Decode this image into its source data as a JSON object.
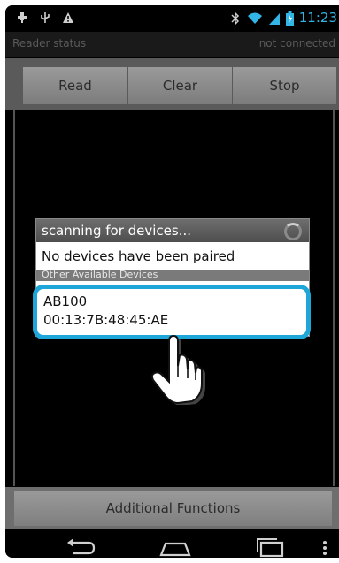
{
  "status_bar": {
    "time": "11:23",
    "left_icons": [
      "usb-icon",
      "usb-debug-icon",
      "warning-icon"
    ],
    "right_icons": [
      "bluetooth-icon",
      "wifi-icon",
      "signal-icon",
      "battery-icon"
    ]
  },
  "reader": {
    "label": "Reader status",
    "value": "not connected"
  },
  "toolbar": {
    "read_label": "Read",
    "clear_label": "Clear",
    "stop_label": "Stop"
  },
  "dialog": {
    "title": "scanning for devices...",
    "no_paired_text": "No devices have been paired",
    "section_header": "Other Available Devices",
    "devices": [
      {
        "name": "AB100",
        "address": "00:13:7B:48:45:AE"
      }
    ]
  },
  "bottom": {
    "additional_label": "Additional Functions"
  },
  "navigation": {
    "icons": [
      "back-icon",
      "home-icon",
      "recent-apps-icon",
      "menu-icon"
    ]
  },
  "colors": {
    "highlight": "#1fa6d9",
    "time": "#33b5e5"
  }
}
